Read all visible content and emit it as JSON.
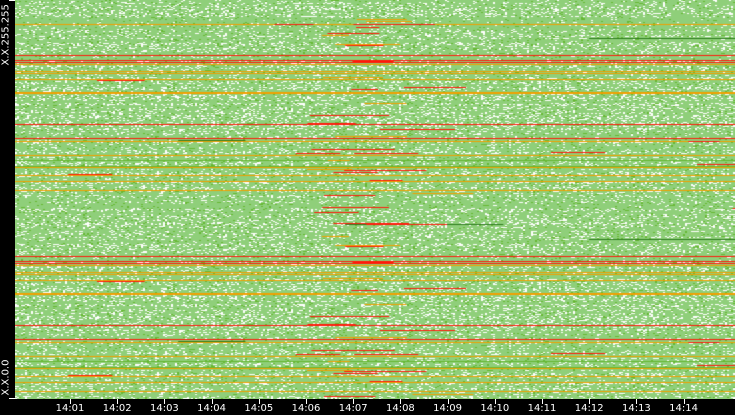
{
  "chart_data": {
    "type": "heatmap",
    "title": "",
    "xlabel": "",
    "ylabel": "",
    "x_ticks": [
      "14:01",
      "14:02",
      "14:03",
      "14:04",
      "14:05",
      "14:06",
      "14:07",
      "14:08",
      "14:09",
      "14:10",
      "14:11",
      "14:12",
      "14:13",
      "14:14"
    ],
    "y_labels": {
      "top": "X.X.255.255",
      "bottom": "X.X.0.0"
    },
    "x_range": [
      "14:00",
      "14:15"
    ],
    "hotspot_time_range": [
      "14:07",
      "14:09"
    ],
    "color_scale": {
      "none": "#ffffff",
      "low": "#8fcf7a",
      "medium": "#66b832",
      "high_dark": "#2e7d1e",
      "elevated": "#f0a000",
      "peak": "#ff1a0a"
    }
  }
}
